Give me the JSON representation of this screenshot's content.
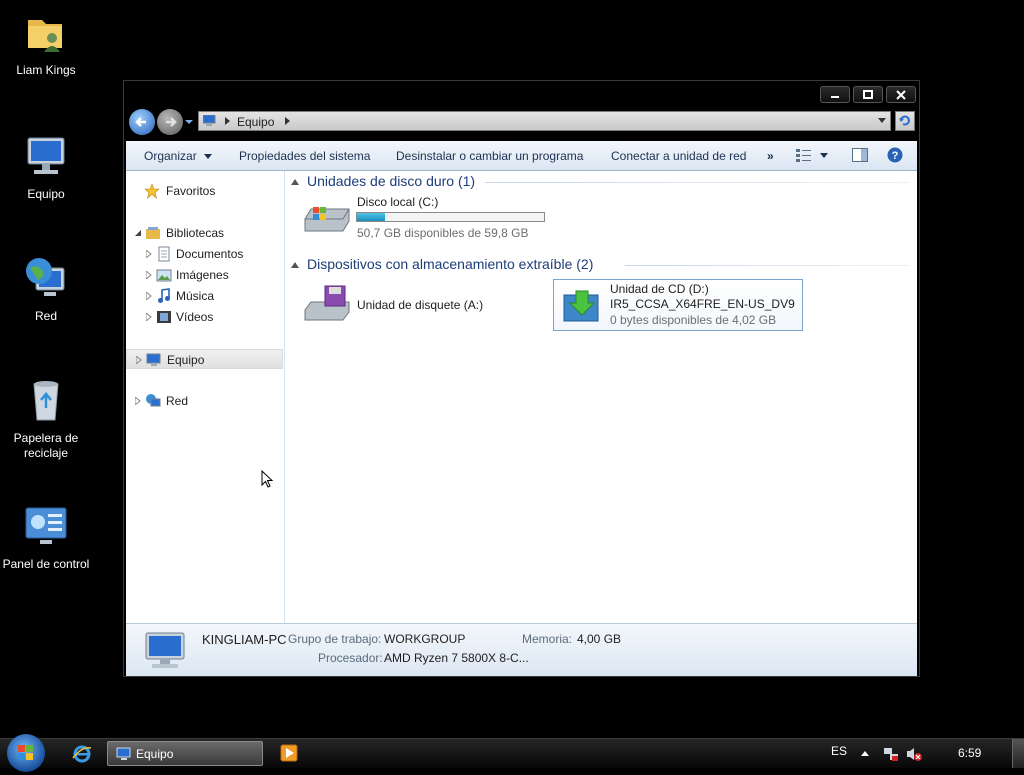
{
  "desktop": {
    "icons": [
      {
        "label": "Liam Kings"
      },
      {
        "label": "Equipo"
      },
      {
        "label": "Red"
      },
      {
        "label": "Papelera de reciclaje"
      },
      {
        "label": "Panel de control"
      }
    ]
  },
  "window": {
    "address": {
      "crumb": "Equipo"
    },
    "toolbar": {
      "organize": "Organizar",
      "system_properties": "Propiedades del sistema",
      "uninstall": "Desinstalar o cambiar un programa",
      "map_drive": "Conectar a unidad de red",
      "more": "»"
    },
    "nav": {
      "favorites": "Favoritos",
      "libraries": "Bibliotecas",
      "documents": "Documentos",
      "images": "Imágenes",
      "music": "Música",
      "videos": "Vídeos",
      "computer": "Equipo",
      "network": "Red"
    },
    "content": {
      "hdd_group": "Unidades de disco duro (1)",
      "local_disk": {
        "name": "Disco local (C:)",
        "free": "50,7 GB disponibles de 59,8 GB",
        "used_fraction": 0.152
      },
      "removable_group": "Dispositivos con almacenamiento extraíble (2)",
      "floppy": {
        "name": "Unidad de disquete (A:)"
      },
      "cd": {
        "name": "Unidad de CD (D:)",
        "label": "IR5_CCSA_X64FRE_EN-US_DV9",
        "free": "0 bytes disponibles de 4,02 GB"
      }
    },
    "details": {
      "computer_name": "KINGLIAM-PC",
      "workgroup_label": "Grupo de trabajo:",
      "workgroup": "WORKGROUP",
      "memory_label": "Memoria:",
      "memory": "4,00 GB",
      "processor_label": "Procesador:",
      "processor": "AMD Ryzen 7 5800X 8-C..."
    }
  },
  "taskbar": {
    "active_window": "Equipo",
    "language": "ES",
    "clock": "6:59"
  },
  "colors": {
    "accent": "#1e3d7b",
    "progress": "#1d8fbe"
  }
}
